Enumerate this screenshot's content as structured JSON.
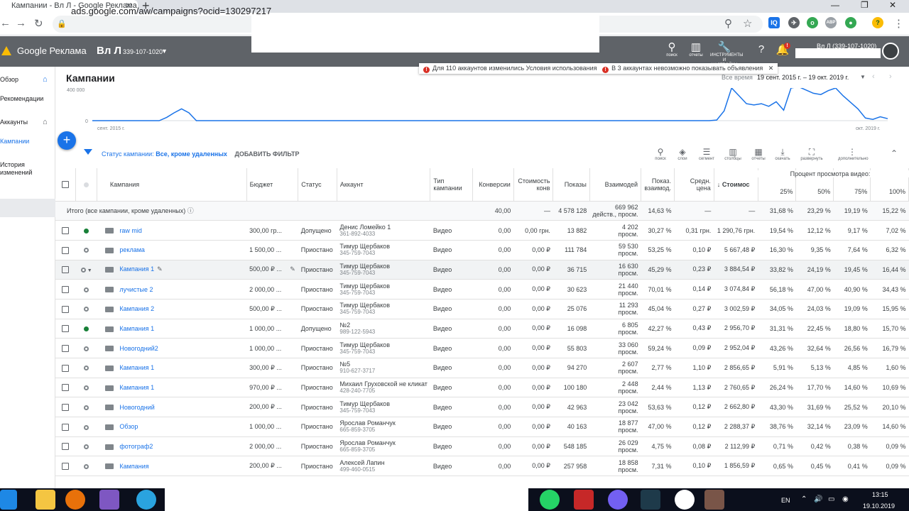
{
  "browser": {
    "tab_title": "Кампании - Вл Л - Google Реклама",
    "url": "ads.google.com/aw/campaigns?ocid=130297217"
  },
  "header": {
    "brand": "Google Реклама",
    "account_name": "Вл Л",
    "account_id": "339-107-1020",
    "account_right": "Вл Л (339-107-1020)",
    "search_label": "поиск",
    "reports_label": "отчеты",
    "tools_label_1": "ИНСТРУМЕНТЫ",
    "tools_label_2": "И НАСТРОЙКИ",
    "notif_badge": "!"
  },
  "sidebar": {
    "items": [
      {
        "label": "Обзор"
      },
      {
        "label": "Рекомендации"
      },
      {
        "label": "Аккаунты"
      },
      {
        "label": "Кампании"
      },
      {
        "label": "История"
      },
      {
        "label": "изменений"
      }
    ]
  },
  "main": {
    "title": "Кампании",
    "notice_1": "Для 110 аккаунтов изменились Условия использования",
    "notice_2": "В 3 аккаунтах невозможно показывать объявления",
    "period_label": "Все время",
    "period_range": "19 сент. 2015 г. – 19 окт. 2019 г.",
    "filter_label": "Статус кампании:",
    "filter_value": "Все, кроме удаленных",
    "add_filter": "ДОБАВИТЬ ФИЛЬТР",
    "toolbar": [
      "поиск",
      "слои",
      "сегмент",
      "столбцы",
      "отчеты",
      "скачать",
      "развернуть",
      "дополнительно"
    ]
  },
  "chart_data": {
    "type": "line",
    "ytick_top": "400 000",
    "ytick_zero": "0",
    "x_start_label": "сент. 2015 г.",
    "x_end_label": "окт. 2019 г.",
    "color": "#1a73e8",
    "values": [
      0,
      0,
      0,
      0,
      0,
      0,
      0,
      0,
      0,
      0,
      50,
      120,
      180,
      120,
      0,
      0,
      0,
      0,
      0,
      0,
      0,
      0,
      0,
      0,
      0,
      0,
      0,
      0,
      0,
      0,
      0,
      0,
      0,
      0,
      0,
      0,
      0,
      0,
      0,
      0,
      0,
      0,
      0,
      0,
      0,
      0,
      0,
      0,
      0,
      0,
      0,
      0,
      0,
      0,
      0,
      0,
      0,
      0,
      0,
      0,
      0,
      0,
      0,
      0,
      0,
      0,
      0,
      0,
      0,
      0,
      0,
      0,
      0,
      0,
      0,
      0,
      0,
      0,
      0,
      0,
      0,
      0,
      0,
      0,
      10,
      150,
      500,
      380,
      260,
      240,
      260,
      220,
      290,
      160,
      500,
      520,
      470,
      420,
      400,
      460,
      500,
      380,
      280,
      180,
      40,
      20,
      60,
      30
    ]
  },
  "table": {
    "headers": {
      "campaign": "Кампания",
      "budget": "Бюджет",
      "status": "Статус",
      "account": "Аккаунт",
      "type": "Тип кампании",
      "conv": "Конверсии",
      "conv_cost": "Стоимость конв",
      "impr": "Показы",
      "inter": "Взаимодей",
      "inter_rate": "Показ. взаимод.",
      "avg_price": "Средн. цена",
      "cost": "Стоимос",
      "video_group": "Процент просмотра видео:",
      "p25": "25%",
      "p50": "50%",
      "p75": "75%",
      "p100": "100%"
    },
    "total": {
      "label": "Итого (все кампании, кроме удаленных)",
      "conv": "40,00",
      "conv_cost": "—",
      "impr": "4 578 128",
      "inter_1": "669 962",
      "inter_2": "действ., просм.",
      "inter_rate": "14,63 %",
      "avg_price": "—",
      "cost": "—",
      "p25": "31,68 %",
      "p50": "23,29 %",
      "p75": "19,19 %",
      "p100": "15,22 %"
    },
    "rows": [
      {
        "name": "raw mid",
        "budget": "300,00 гр...",
        "status": "Допущено",
        "acc_name": "Денис Ломейко 1",
        "acc_id": "361-892-4033",
        "type": "Видео",
        "conv": "0,00",
        "conv_cost": "0,00 грн.",
        "impr": "13 882",
        "inter_1": "4 202",
        "inter_2": "просм.",
        "inter_rate": "30,27 %",
        "avg_price": "0,31 грн.",
        "cost": "1 290,76 грн.",
        "p25": "19,54 %",
        "p50": "12,12 %",
        "p75": "9,17 %",
        "p100": "7,02 %"
      },
      {
        "name": "реклама",
        "budget": "1 500,00 ...",
        "status": "Приостано",
        "acc_name": "Тимур Щербаков",
        "acc_id": "345-759-7043",
        "type": "Видео",
        "conv": "0,00",
        "conv_cost": "0,00 ₽",
        "impr": "111 784",
        "inter_1": "59 530",
        "inter_2": "просм.",
        "inter_rate": "53,25 %",
        "avg_price": "0,10 ₽",
        "cost": "5 667,48 ₽",
        "p25": "16,30 %",
        "p50": "9,35 %",
        "p75": "7,64 %",
        "p100": "6,32 %"
      },
      {
        "name": "Кампания 1",
        "budget": "500,00 ₽ ...",
        "status": "Приостано",
        "acc_name": "Тимур Щербаков",
        "acc_id": "345-759-7043",
        "type": "Видео",
        "conv": "0,00",
        "conv_cost": "0,00 ₽",
        "impr": "36 715",
        "inter_1": "16 630",
        "inter_2": "просм.",
        "inter_rate": "45,29 %",
        "avg_price": "0,23 ₽",
        "cost": "3 884,54 ₽",
        "p25": "33,82 %",
        "p50": "24,19 %",
        "p75": "19,45 %",
        "p100": "16,44 %"
      },
      {
        "name": "лучистые 2",
        "budget": "2 000,00 ...",
        "status": "Приостано",
        "acc_name": "Тимур Щербаков",
        "acc_id": "345-759-7043",
        "type": "Видео",
        "conv": "0,00",
        "conv_cost": "0,00 ₽",
        "impr": "30 623",
        "inter_1": "21 440",
        "inter_2": "просм.",
        "inter_rate": "70,01 %",
        "avg_price": "0,14 ₽",
        "cost": "3 074,84 ₽",
        "p25": "56,18 %",
        "p50": "47,00 %",
        "p75": "40,90 %",
        "p100": "34,43 %"
      },
      {
        "name": "Кампания 2",
        "budget": "500,00 ₽ ...",
        "status": "Приостано",
        "acc_name": "Тимур Щербаков",
        "acc_id": "345-759-7043",
        "type": "Видео",
        "conv": "0,00",
        "conv_cost": "0,00 ₽",
        "impr": "25 076",
        "inter_1": "11 293",
        "inter_2": "просм.",
        "inter_rate": "45,04 %",
        "avg_price": "0,27 ₽",
        "cost": "3 002,59 ₽",
        "p25": "34,05 %",
        "p50": "24,03 %",
        "p75": "19,09 %",
        "p100": "15,95 %"
      },
      {
        "name": "Кампания 1",
        "budget": "1 000,00 ...",
        "status": "Допущено",
        "acc_name": "№2",
        "acc_id": "989-122-5943",
        "type": "Видео",
        "conv": "0,00",
        "conv_cost": "0,00 ₽",
        "impr": "16 098",
        "inter_1": "6 805",
        "inter_2": "просм.",
        "inter_rate": "42,27 %",
        "avg_price": "0,43 ₽",
        "cost": "2 956,70 ₽",
        "p25": "31,31 %",
        "p50": "22,45 %",
        "p75": "18,80 %",
        "p100": "15,70 %"
      },
      {
        "name": "Новогодний2",
        "budget": "1 000,00 ...",
        "status": "Приостано",
        "acc_name": "Тимур Щербаков",
        "acc_id": "345-759-7043",
        "type": "Видео",
        "conv": "0,00",
        "conv_cost": "0,00 ₽",
        "impr": "55 803",
        "inter_1": "33 060",
        "inter_2": "просм.",
        "inter_rate": "59,24 %",
        "avg_price": "0,09 ₽",
        "cost": "2 952,04 ₽",
        "p25": "43,26 %",
        "p50": "32,64 %",
        "p75": "26,56 %",
        "p100": "16,79 %"
      },
      {
        "name": "Кампания 1",
        "budget": "300,00 ₽ ...",
        "status": "Приостано",
        "acc_name": "№5",
        "acc_id": "910-627-3717",
        "type": "Видео",
        "conv": "0,00",
        "conv_cost": "0,00 ₽",
        "impr": "94 270",
        "inter_1": "2 607",
        "inter_2": "просм.",
        "inter_rate": "2,77 %",
        "avg_price": "1,10 ₽",
        "cost": "2 856,65 ₽",
        "p25": "5,91 %",
        "p50": "5,13 %",
        "p75": "4,85 %",
        "p100": "1,60 %"
      },
      {
        "name": "Кампания 1",
        "budget": "970,00 ₽ ...",
        "status": "Приостано",
        "acc_name": "Михаил Груховской не кликат",
        "acc_id": "428-240-7705",
        "type": "Видео",
        "conv": "0,00",
        "conv_cost": "0,00 ₽",
        "impr": "100 180",
        "inter_1": "2 448",
        "inter_2": "просм.",
        "inter_rate": "2,44 %",
        "avg_price": "1,13 ₽",
        "cost": "2 760,65 ₽",
        "p25": "26,24 %",
        "p50": "17,70 %",
        "p75": "14,60 %",
        "p100": "10,69 %"
      },
      {
        "name": "Новогодний",
        "budget": "200,00 ₽ ...",
        "status": "Приостано",
        "acc_name": "Тимур Щербаков",
        "acc_id": "345-759-7043",
        "type": "Видео",
        "conv": "0,00",
        "conv_cost": "0,00 ₽",
        "impr": "42 963",
        "inter_1": "23 042",
        "inter_2": "просм.",
        "inter_rate": "53,63 %",
        "avg_price": "0,12 ₽",
        "cost": "2 662,80 ₽",
        "p25": "43,30 %",
        "p50": "31,69 %",
        "p75": "25,52 %",
        "p100": "20,10 %"
      },
      {
        "name": "Обзор",
        "budget": "1 000,00 ...",
        "status": "Приостано",
        "acc_name": "Ярослав Романчук",
        "acc_id": "665-859-3705",
        "type": "Видео",
        "conv": "0,00",
        "conv_cost": "0,00 ₽",
        "impr": "40 163",
        "inter_1": "18 877",
        "inter_2": "просм.",
        "inter_rate": "47,00 %",
        "avg_price": "0,12 ₽",
        "cost": "2 288,37 ₽",
        "p25": "38,76 %",
        "p50": "32,14 %",
        "p75": "23,09 %",
        "p100": "14,60 %"
      },
      {
        "name": "фотограф2",
        "budget": "2 000,00 ...",
        "status": "Приостано",
        "acc_name": "Ярослав Романчук",
        "acc_id": "665-859-3705",
        "type": "Видео",
        "conv": "0,00",
        "conv_cost": "0,00 ₽",
        "impr": "548 185",
        "inter_1": "26 029",
        "inter_2": "просм.",
        "inter_rate": "4,75 %",
        "avg_price": "0,08 ₽",
        "cost": "2 112,99 ₽",
        "p25": "0,71 %",
        "p50": "0,42 %",
        "p75": "0,38 %",
        "p100": "0,09 %"
      },
      {
        "name": "Кампания",
        "budget": "200,00 ₽ ...",
        "status": "Приостано",
        "acc_name": "Алексей Лапин",
        "acc_id": "499-460-0515",
        "type": "Видео",
        "conv": "0,00",
        "conv_cost": "0,00 ₽",
        "impr": "257 958",
        "inter_1": "18 858",
        "inter_2": "просм.",
        "inter_rate": "7,31 %",
        "avg_price": "0,10 ₽",
        "cost": "1 856,59 ₽",
        "p25": "0,65 %",
        "p50": "0,45 %",
        "p75": "0,41 %",
        "p100": "0,09 %"
      }
    ]
  },
  "taskbar": {
    "lang": "EN",
    "time": "13:15",
    "date": "19.10.2019"
  }
}
